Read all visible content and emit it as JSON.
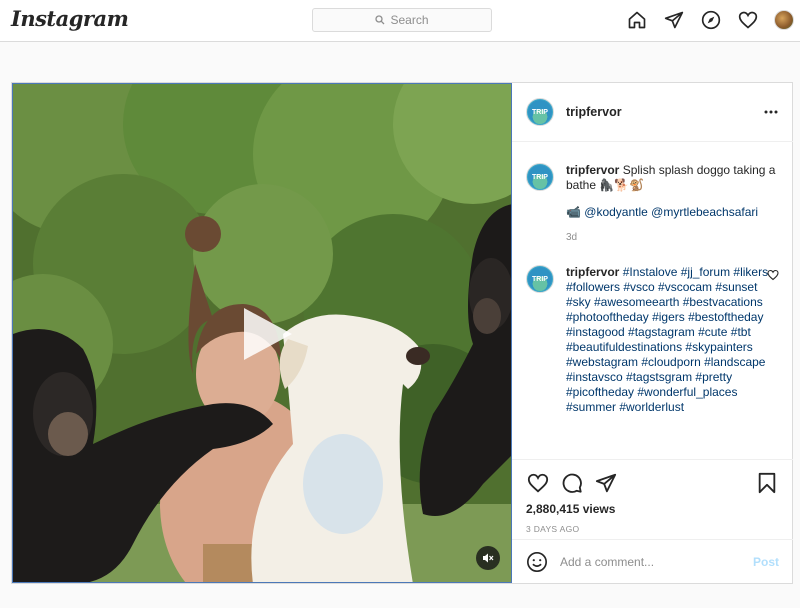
{
  "topbar": {
    "logo": "Instagram",
    "search_placeholder": "Search"
  },
  "post": {
    "username": "tripfervor",
    "avatar_text": "TRIP\nFERVOR",
    "caption_user": "tripfervor",
    "caption_text": "Splish splash doggo taking a bathe 🦍🐕🐒",
    "mentions": "📹 @kodyantle @myrtlebeachsafari",
    "caption_age": "3d",
    "comment_user": "tripfervor",
    "comment_hashtags": "#Instalove #jj_forum #likers #followers #vsco #vscocam #sunset #sky #awesomeearth #bestvacations #photooftheday #igers #bestoftheday #instagood #tagstagram #cute #tbt #beautifuldestinations #skypainters #webstagram #cloudporn #landscape #instavsco #tagstsgram #pretty #picoftheday #wonderful_places #summer #worlderlust",
    "views": "2,880,415 views",
    "timestamp": "3 DAYS AGO",
    "comment_placeholder": "Add a comment...",
    "post_button": "Post"
  },
  "colors": {
    "link": "#00376b",
    "post_button": "#b2dffc",
    "border": "#dbdbdb"
  },
  "icons": {
    "nav": [
      "home-icon",
      "direct-icon",
      "explore-icon",
      "heart-icon",
      "avatar"
    ],
    "actions": [
      "like-icon",
      "comment-icon",
      "share-icon",
      "save-icon"
    ]
  }
}
